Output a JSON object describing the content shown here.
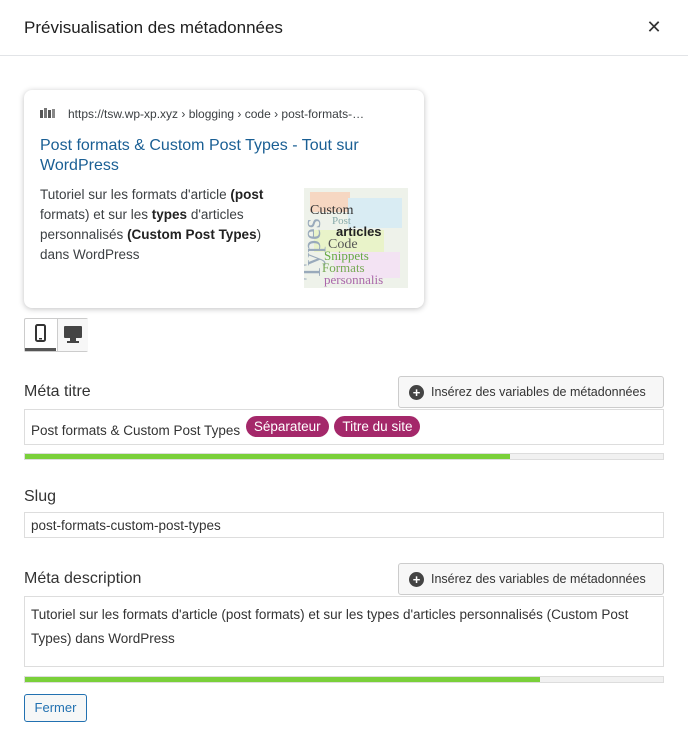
{
  "modal": {
    "title": "Prévisualisation des métadonnées",
    "close_icon": "close-icon"
  },
  "preview": {
    "url": "https://tsw.wp-xp.xyz › blogging › code › post-formats-…",
    "title": "Post formats & Custom Post Types - Tout sur WordPress",
    "description_parts": {
      "p1": "Tutoriel sur les formats d'article ",
      "b1": "(post",
      "p2": "formats) et sur les ",
      "b2": "types",
      "p3": " d'articles personnalisés ",
      "b3": "(Custom Post Types",
      "p4": ") dans WordPress"
    },
    "thumbnail_words": [
      "Custom",
      "Post",
      "Types",
      "articles",
      "Code",
      "Snippets",
      "Formats",
      "personnalis"
    ]
  },
  "devices": {
    "mobile_icon": "mobile-icon",
    "desktop_icon": "desktop-icon",
    "selected": "mobile"
  },
  "meta_title": {
    "label": "Méta titre",
    "insert_button": "Insérez des variables de métadonnées",
    "text": "Post formats & Custom Post Types",
    "tags": [
      "Séparateur",
      "Titre du site"
    ],
    "progress": 0.76
  },
  "slug": {
    "label": "Slug",
    "value": "post-formats-custom-post-types"
  },
  "meta_description": {
    "label": "Méta description",
    "insert_button": "Insérez des variables de métadonnées",
    "text": "Tutoriel sur les formats d'article (post formats) et sur les types d'articles personnalisés (Custom Post Types) dans WordPress",
    "progress": 0.807
  },
  "footer": {
    "close_button": "Fermer"
  },
  "colors": {
    "link": "#1a5f94",
    "tag": "#a4286a",
    "progress_good": "#7ad03a",
    "button_blue": "#2271b1"
  }
}
